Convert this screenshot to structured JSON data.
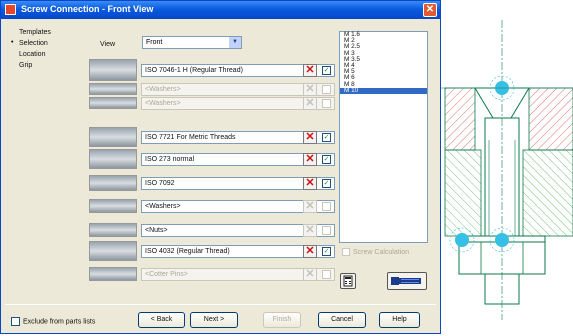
{
  "window": {
    "title": "Screw Connection - Front View"
  },
  "nav": {
    "items": [
      {
        "label": "Templates"
      },
      {
        "label": "Selection"
      },
      {
        "label": "Location"
      },
      {
        "label": "Grip"
      }
    ],
    "active_index": 1
  },
  "view": {
    "label": "View",
    "value": "Front"
  },
  "components": [
    {
      "value": "ISO 7046-1  H  (Regular Thread)",
      "enabled": true,
      "checked": true,
      "icon": "countersunk-screw-icon"
    },
    {
      "value": "<Washers>",
      "enabled": false,
      "checked": false,
      "icon": "washer-icon"
    },
    {
      "value": "<Washers>",
      "enabled": false,
      "checked": false,
      "icon": "washer-icon"
    },
    {
      "value": "ISO 7721  For Metric Threads",
      "enabled": true,
      "checked": true,
      "icon": "countersink-hole-icon"
    },
    {
      "value": "ISO 273 normal",
      "enabled": true,
      "checked": true,
      "icon": "through-hole-icon"
    },
    {
      "value": "ISO 7092",
      "enabled": true,
      "checked": true,
      "icon": "washer-icon"
    },
    {
      "value": "<Washers>",
      "enabled": true,
      "checked": false,
      "icon": "washer-icon"
    },
    {
      "value": "<Nuts>",
      "enabled": true,
      "checked": false,
      "icon": "nut-icon"
    },
    {
      "value": "ISO 4032  (Regular Thread)",
      "enabled": true,
      "checked": true,
      "icon": "hex-nut-icon"
    },
    {
      "value": "<Cotter Pins>",
      "enabled": false,
      "checked": false,
      "icon": "cotter-pin-icon"
    }
  ],
  "sizes": {
    "items": [
      "M 1.6",
      "M 2",
      "M 2.5",
      "M 3",
      "M 3.5",
      "M 4",
      "M 5",
      "M 6",
      "M 8",
      "M 10"
    ],
    "selected_index": 9
  },
  "screw_calculation_label": "Screw Calculation",
  "exclude_label": "Exclude from parts lists",
  "buttons": {
    "back": "< Back",
    "next": "Next >",
    "finish": "Finish",
    "cancel": "Cancel",
    "help": "Help"
  },
  "colors": {
    "title_bar": "#0a5be0",
    "dialog_bg": "#ece9d8",
    "selection": "#316ac5",
    "delete_red": "#d01010",
    "drawing_hatch": "#d9534f",
    "drawing_grip": "#36c0e6",
    "drawing_outline": "#0b7a4b"
  }
}
